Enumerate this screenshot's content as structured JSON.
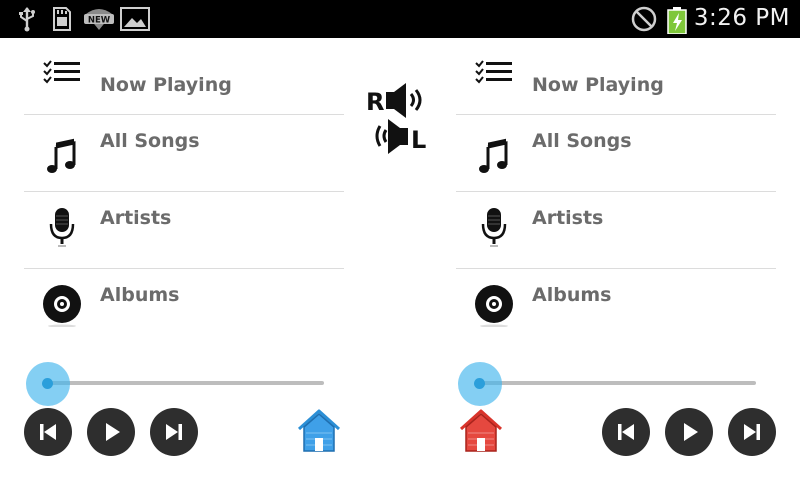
{
  "status_bar": {
    "time": "3:26 PM",
    "icons": [
      "usb-icon",
      "sd-card-icon",
      "wifi-new-icon",
      "image-icon",
      "no-sim-icon",
      "battery-charging-icon"
    ],
    "new_badge": "NEW"
  },
  "left_panel": {
    "menu": [
      {
        "label": "Now Playing",
        "icon": "playlist-icon"
      },
      {
        "label": "All Songs",
        "icon": "music-note-icon"
      },
      {
        "label": "Artists",
        "icon": "microphone-icon"
      },
      {
        "label": "Albums",
        "icon": "album-disc-icon"
      }
    ],
    "seek_progress": 0,
    "controls": [
      "previous-icon",
      "play-icon",
      "next-icon"
    ],
    "home_color": "#2b8fd6"
  },
  "right_panel": {
    "menu": [
      {
        "label": "Now Playing",
        "icon": "playlist-icon"
      },
      {
        "label": "All Songs",
        "icon": "music-note-icon"
      },
      {
        "label": "Artists",
        "icon": "microphone-icon"
      },
      {
        "label": "Albums",
        "icon": "album-disc-icon"
      }
    ],
    "seek_progress": 0,
    "controls": [
      "previous-icon",
      "play-icon",
      "next-icon"
    ],
    "home_color": "#d9342b"
  },
  "center": {
    "swap_right_letter": "R",
    "swap_left_letter": "L",
    "icon": "swap-channels-icon"
  },
  "colors": {
    "label": "#6b6b6b",
    "divider": "#dcdcdc",
    "slider_thumb": "#42b5ec",
    "button_bg": "#2e2e2e"
  }
}
